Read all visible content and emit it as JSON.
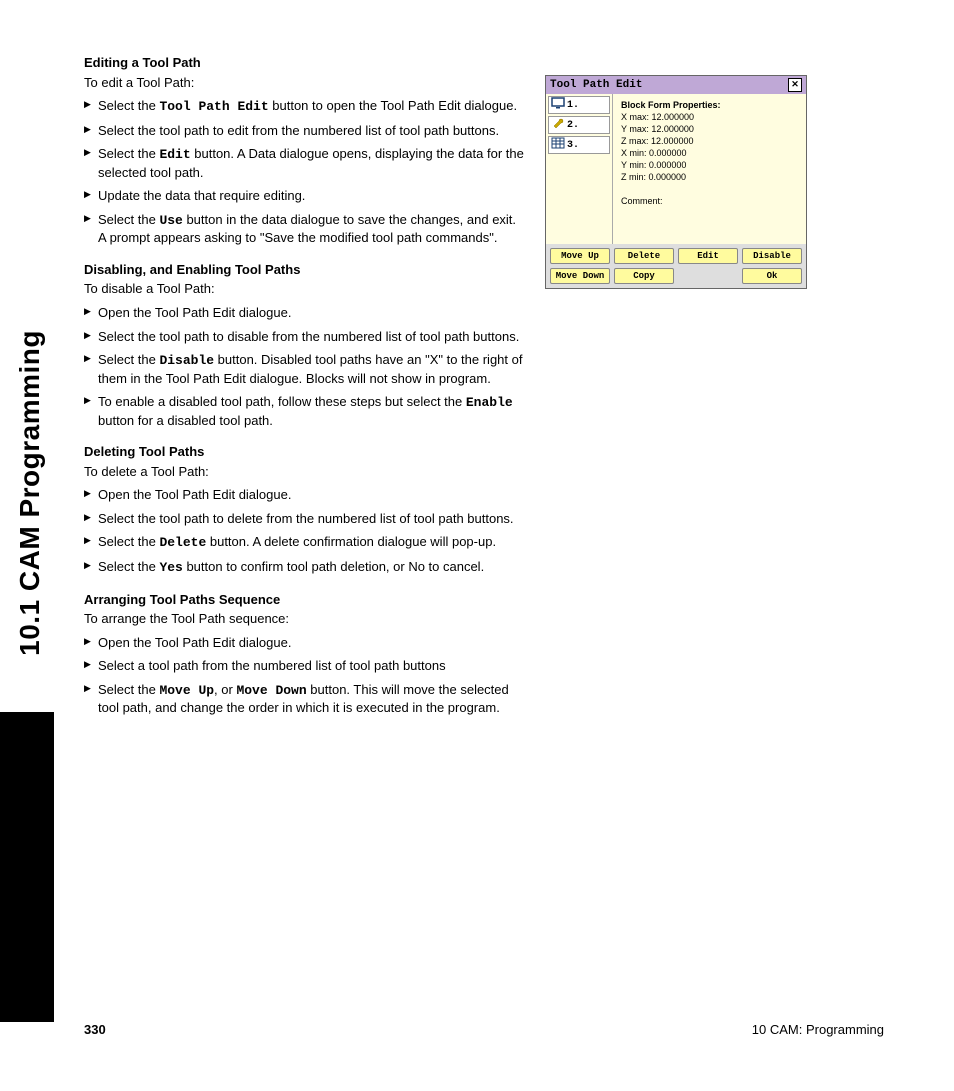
{
  "sideTab": "10.1 CAM Programming",
  "sections": [
    {
      "title": "Editing a Tool Path",
      "intro": "To edit a Tool Path:",
      "bullets": [
        {
          "pre": "Select the ",
          "mono": "Tool Path Edit",
          "post": " button to open the Tool Path Edit dialogue."
        },
        {
          "pre": "Select the tool path to edit from the numbered list of tool path buttons.",
          "mono": "",
          "post": ""
        },
        {
          "pre": "Select the ",
          "mono": "Edit",
          "post": " button. A Data dialogue opens, displaying the data for the selected tool path."
        },
        {
          "pre": "Update the data that require editing.",
          "mono": "",
          "post": ""
        },
        {
          "pre": "Select the ",
          "mono": "Use",
          "post": " button in the data dialogue to save the changes, and exit.  A prompt appears asking to \"Save the modified tool path commands\"."
        }
      ]
    },
    {
      "title": "Disabling, and Enabling Tool Paths",
      "intro": "To disable a Tool Path:",
      "bullets": [
        {
          "pre": "Open the Tool Path Edit dialogue.",
          "mono": "",
          "post": ""
        },
        {
          "pre": "Select the tool path to disable from the numbered list of tool path buttons.",
          "mono": "",
          "post": ""
        },
        {
          "pre": "Select the ",
          "mono": "Disable",
          "post": " button. Disabled tool paths have an \"X\" to the right of them in the Tool Path Edit dialogue. Blocks will not show in program."
        },
        {
          "pre": "To enable a disabled tool path, follow these steps but select the ",
          "mono": "Enable",
          "post": " button for a disabled tool path."
        }
      ]
    },
    {
      "title": "Deleting Tool Paths",
      "intro": "To delete a Tool Path:",
      "bullets": [
        {
          "pre": "Open the Tool Path Edit dialogue.",
          "mono": "",
          "post": ""
        },
        {
          "pre": "Select the tool path to delete from the numbered list of tool path buttons.",
          "mono": "",
          "post": ""
        },
        {
          "pre": "Select the ",
          "mono": "Delete",
          "post": " button. A delete confirmation dialogue will pop-up."
        },
        {
          "pre": "Select the ",
          "mono": "Yes",
          "post": " button to confirm tool path deletion, or No to cancel."
        }
      ]
    },
    {
      "title": "Arranging Tool Paths Sequence",
      "intro": "To arrange the Tool Path sequence:",
      "bullets": [
        {
          "pre": "Open the Tool Path Edit dialogue.",
          "mono": "",
          "post": ""
        },
        {
          "pre": "Select a tool path from the numbered list of tool path buttons",
          "mono": "",
          "post": ""
        },
        {
          "pre": "Select the ",
          "mono": "Move Up",
          "mid": ", or ",
          "mono2": "Move Down",
          "post": " button. This will move the selected tool path, and change the order in which it is executed in the program."
        }
      ]
    }
  ],
  "footer": {
    "pageNum": "330",
    "chapter": "10 CAM: Programming"
  },
  "dialog": {
    "title": "Tool Path Edit",
    "close": "✕",
    "items": [
      {
        "num": "1.",
        "icon": "monitor"
      },
      {
        "num": "2.",
        "icon": "wrench"
      },
      {
        "num": "3.",
        "icon": "grid"
      }
    ],
    "propsTitle": "Block Form Properties:",
    "props": [
      "X max: 12.000000",
      "Y max: 12.000000",
      "Z max: 12.000000",
      "X min: 0.000000",
      "Y min: 0.000000",
      "Z min: 0.000000",
      "",
      "Comment:"
    ],
    "buttons": [
      "Move Up",
      "Delete",
      "Edit",
      "Disable",
      "Move Down",
      "Copy",
      "",
      "Ok"
    ]
  }
}
